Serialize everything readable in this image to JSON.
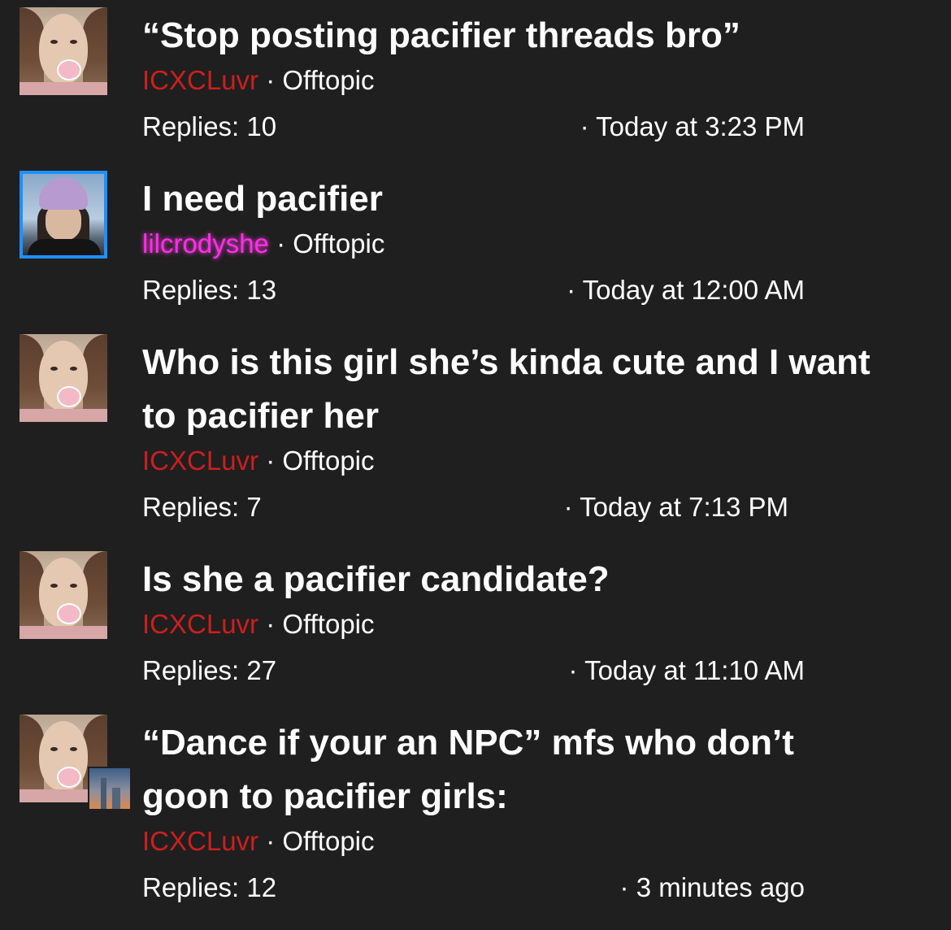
{
  "threads": [
    {
      "title": "“Stop posting pacifier threads bro”",
      "author": "ICXCLuvr",
      "separator": "·",
      "forum": "Offtopic",
      "replies": "Replies: 10",
      "time": "· Today at 3:23 PM"
    },
    {
      "title": "I need pacifier",
      "author": "lilcrodyshe",
      "separator": "·",
      "forum": "Offtopic",
      "replies": "Replies: 13",
      "time": "· Today at 12:00 AM"
    },
    {
      "title": "Who is this girl she’s kinda cute and I want to pacifier her",
      "author": "ICXCLuvr",
      "separator": "·",
      "forum": "Offtopic",
      "replies": "Replies: 7",
      "time": "· Today at 7:13 PM"
    },
    {
      "title": "Is she a pacifier candidate?",
      "author": "ICXCLuvr",
      "separator": "·",
      "forum": "Offtopic",
      "replies": "Replies: 27",
      "time": "· Today at 11:10 AM"
    },
    {
      "title": "“Dance if your an NPC” mfs who don’t goon to pacifier girls:",
      "author": "ICXCLuvr",
      "separator": "·",
      "forum": "Offtopic",
      "replies": "Replies: 12",
      "time": "· 3 minutes ago"
    }
  ],
  "colors": {
    "background": "#1f1f1f",
    "author_red": "#cc1f1f",
    "author_pink": "#ff2ee6",
    "avatar_border_blue": "#1e90ff"
  }
}
